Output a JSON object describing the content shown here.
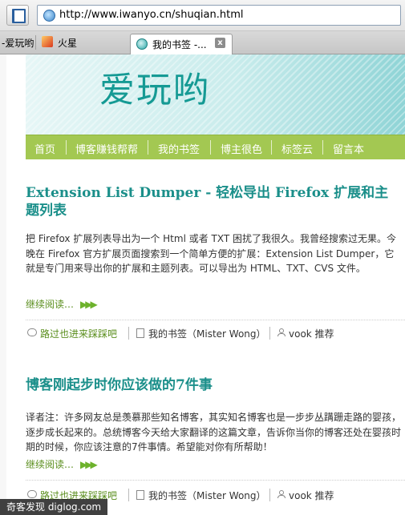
{
  "browser": {
    "url": "http://www.iwanyo.cn/shuqian.html",
    "bookmarks": [
      "-爱玩哟",
      "火星"
    ],
    "active_tab_label": "我的书签 -...",
    "tab_close": "x"
  },
  "site": {
    "title": "爱玩哟",
    "nav": [
      "首页",
      "博客赚钱帮帮",
      "我的书签",
      "博主很色",
      "标签云",
      "留言本"
    ]
  },
  "posts": [
    {
      "title": "Extension List Dumper - 轻松导出  Firefox 扩展和主题列表",
      "body": "把 Firefox 扩展列表导出为一个 Html 或者 TXT 困扰了我很久。我曾经搜索过无果。今晚在 Firefox 官方扩展页面搜索到一个简单方便的扩展：Extension List Dumper，它就是专门用来导出你的扩展和主题列表。可以导出为 HTML、TXT、CVS 文件。",
      "read_more": "继续阅读…",
      "comment_link": "路过也进来踩踩吧",
      "category": "我的书签（Mister Wong）",
      "author": "vook 推荐"
    },
    {
      "title": "博客刚起步时你应该做的7件事",
      "body": "译者注：许多网友总是羡慕那些知名博客，其实知名博客也是一步步丛蹒跚走路的婴孩，逐步成长起来的。总统博客今天给大家翻译的这篇文章，告诉你当你的博客还处在婴孩时期的时候，你应该注意的7件事情。希望能对你有所帮助！",
      "read_more": "继续阅读…",
      "comment_link": "路过也进来踩踩吧",
      "category": "我的书签（Mister Wong）",
      "author": "vook 推荐"
    }
  ],
  "watermark": "奇客发现 diglog.com",
  "colors": {
    "accent_teal": "#1b8f8a",
    "nav_green": "#a3c852",
    "link_green": "#5a8e1d"
  }
}
